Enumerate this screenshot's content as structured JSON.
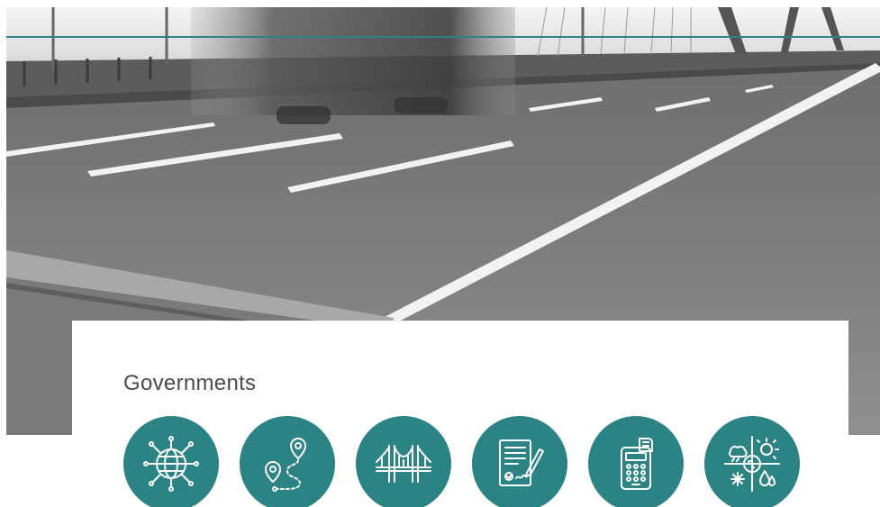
{
  "hero": {
    "image": "blurred-truck-on-bridge-photo",
    "accent_color": "#2c8384"
  },
  "section": {
    "title": "Governments"
  },
  "icons": [
    {
      "name": "globe-network-icon"
    },
    {
      "name": "route-map-pin-icon"
    },
    {
      "name": "suspension-bridge-icon"
    },
    {
      "name": "signed-document-icon"
    },
    {
      "name": "parking-meter-icon"
    },
    {
      "name": "weather-environment-icon"
    }
  ],
  "colors": {
    "accent": "#2c8384",
    "title_text": "#4a4a4a",
    "panel_bg": "#ffffff"
  }
}
